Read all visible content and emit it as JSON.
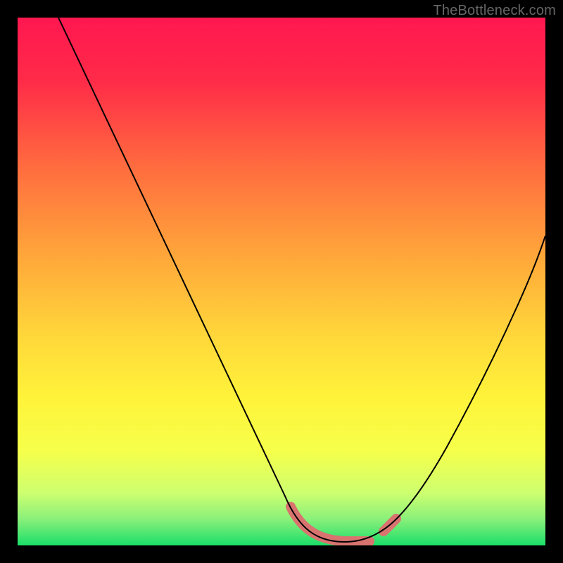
{
  "watermark": "TheBottleneck.com",
  "chart_data": {
    "type": "line",
    "title": "",
    "xlabel": "",
    "ylabel": "",
    "x": [
      0.0,
      0.05,
      0.1,
      0.15,
      0.2,
      0.25,
      0.3,
      0.35,
      0.4,
      0.45,
      0.5,
      0.55,
      0.6,
      0.63,
      0.66,
      0.7,
      0.75,
      0.8,
      0.85,
      0.9,
      0.95,
      1.0
    ],
    "series": [
      {
        "name": "bottleneck-curve",
        "values": [
          1.0,
          0.9,
          0.8,
          0.7,
          0.6,
          0.5,
          0.4,
          0.3,
          0.2,
          0.12,
          0.06,
          0.02,
          0.0,
          0.0,
          0.0,
          0.02,
          0.07,
          0.15,
          0.25,
          0.37,
          0.48,
          0.6
        ]
      }
    ],
    "xlim": [
      0,
      1
    ],
    "ylim": [
      0,
      1
    ],
    "highlight_range_x": [
      0.52,
      0.7
    ],
    "background_gradient": [
      "#ff1750",
      "#ff5b3f",
      "#ffb63a",
      "#ffe83a",
      "#fcff56",
      "#d0ff70",
      "#28e06a"
    ],
    "notes": "Axes not labeled in image; x and y normalized 0-1. Curve depicts bottleneck percentage vs component balance; minimum (0) around x≈0.60-0.66 traces in salmon."
  }
}
